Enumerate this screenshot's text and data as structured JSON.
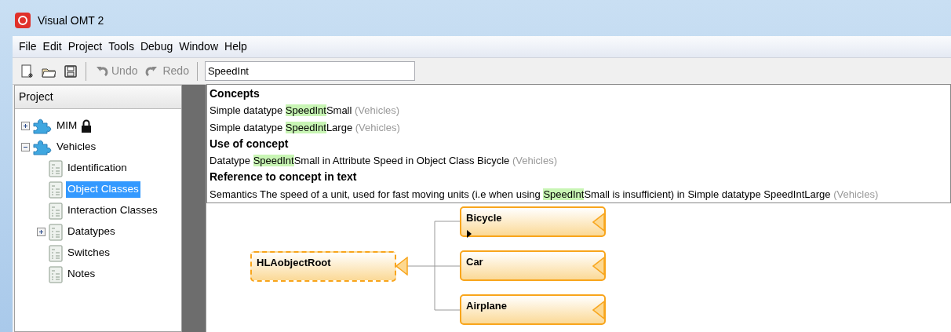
{
  "window": {
    "title": "Visual OMT 2"
  },
  "menu": [
    "File",
    "Edit",
    "Project",
    "Tools",
    "Debug",
    "Window",
    "Help"
  ],
  "toolbar": [
    {
      "kind": "new"
    },
    {
      "kind": "open"
    },
    {
      "kind": "save"
    },
    {
      "kind": "undo",
      "label": "Undo",
      "disabled": true
    },
    {
      "kind": "redo",
      "label": "Redo",
      "disabled": true
    }
  ],
  "search": {
    "value": "SpeedInt"
  },
  "results": [
    {
      "heading": "Concepts",
      "items": [
        {
          "before": "Simple datatype ",
          "match": "SpeedInt",
          "after": "Small ",
          "context": "(Vehicles)"
        },
        {
          "before": "Simple datatype ",
          "match": "SpeedInt",
          "after": "Large ",
          "context": "(Vehicles)"
        }
      ]
    },
    {
      "heading": "Use of concept",
      "items": [
        {
          "before": "Datatype ",
          "match": "SpeedInt",
          "after": "Small in Attribute Speed in Object Class Bicycle ",
          "context": "(Vehicles)"
        }
      ]
    },
    {
      "heading": "Reference to concept in text",
      "items": [
        {
          "before": "Semantics The speed of a unit, used for fast moving units (i.e when using ",
          "match": "SpeedInt",
          "after": "Small is insufficient) in Simple datatype SpeedIntLarge ",
          "context": "(Vehicles)"
        }
      ]
    }
  ],
  "project": {
    "title": "Project",
    "tree": [
      {
        "label": "MIM",
        "kind": "module",
        "locked": true,
        "expanded": false,
        "selected": false
      },
      {
        "label": "Vehicles",
        "kind": "module",
        "expanded": true,
        "selected": false,
        "children": [
          {
            "label": "Identification",
            "kind": "page",
            "selected": false
          },
          {
            "label": "Object Classes",
            "kind": "page",
            "selected": true
          },
          {
            "label": "Interaction Classes",
            "kind": "page",
            "selected": false
          },
          {
            "label": "Datatypes",
            "kind": "page",
            "expandable": true,
            "selected": false
          },
          {
            "label": "Switches",
            "kind": "page",
            "selected": false
          },
          {
            "label": "Notes",
            "kind": "page",
            "selected": false
          }
        ]
      }
    ]
  },
  "diagram": {
    "root": {
      "name": "HLAobjectRoot",
      "dashed": true
    },
    "classes": [
      {
        "name": "Bicycle",
        "dashed": false,
        "expandable": true
      },
      {
        "name": "Car",
        "dashed": false
      },
      {
        "name": "Airplane",
        "dashed": false
      }
    ]
  }
}
